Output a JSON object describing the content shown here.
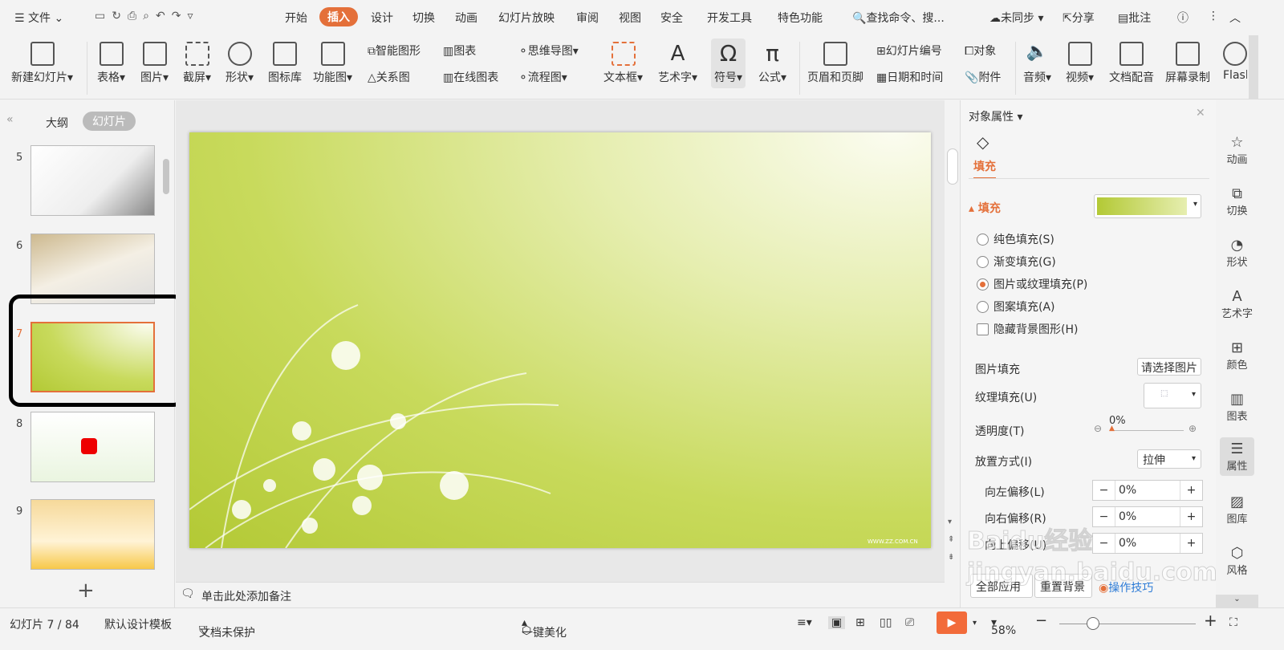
{
  "menubar": {
    "file": "文件",
    "tabs": [
      "开始",
      "插入",
      "设计",
      "切换",
      "动画",
      "幻灯片放映",
      "审阅",
      "视图",
      "安全",
      "开发工具",
      "特色功能"
    ],
    "active_tab": "插入",
    "search": "查找命令、搜...",
    "sync": "未同步",
    "share": "分享",
    "comment": "批注"
  },
  "ribbon": {
    "new_slide": "新建幻灯片",
    "table": "表格",
    "picture": "图片",
    "screenshot": "截屏",
    "shape": "形状",
    "icon_lib": "图标库",
    "func_chart": "功能图",
    "smart_art": "智能图形",
    "chart": "图表",
    "relation": "关系图",
    "online_chart": "在线图表",
    "mind_map": "思维导图",
    "flowchart": "流程图",
    "textbox": "文本框",
    "wordart": "艺术字",
    "symbol": "符号",
    "formula": "公式",
    "header_footer": "页眉和页脚",
    "slide_number": "幻灯片编号",
    "object": "对象",
    "date_time": "日期和时间",
    "attachment": "附件",
    "audio": "音频",
    "video": "视频",
    "voiceover": "文档配音",
    "screen_record": "屏幕录制",
    "flash": "Flash"
  },
  "left_panel": {
    "tab_outline": "大纲",
    "tab_slides": "幻灯片",
    "slides": [
      {
        "num": "5"
      },
      {
        "num": "6"
      },
      {
        "num": "7",
        "selected": true
      },
      {
        "num": "8"
      },
      {
        "num": "9"
      }
    ]
  },
  "slide": {
    "watermark": "WWW.ZZ.COM.CN"
  },
  "notes": "单击此处添加备注",
  "right_panel": {
    "title": "对象属性",
    "tab": "填充",
    "section": "填充",
    "options": [
      {
        "label": "纯色填充(S)",
        "checked": false
      },
      {
        "label": "渐变填充(G)",
        "checked": false
      },
      {
        "label": "图片或纹理填充(P)",
        "checked": true
      },
      {
        "label": "图案填充(A)",
        "checked": false
      }
    ],
    "hide_bg": "隐藏背景图形(H)",
    "picture_fill": "图片填充",
    "picture_fill_btn": "请选择图片",
    "texture_fill": "纹理填充(U)",
    "transparency": "透明度(T)",
    "transparency_value": "0%",
    "transparency_level": 0,
    "placement": "放置方式(I)",
    "placement_value": "拉伸",
    "offsets": [
      {
        "label": "向左偏移(L)",
        "value": "0%"
      },
      {
        "label": "向右偏移(R)",
        "value": "0%"
      },
      {
        "label": "向上偏移(U)",
        "value": "0%"
      }
    ],
    "apply_all": "全部应用",
    "reset_bg": "重置背景",
    "tips": "操作技巧"
  },
  "side_icons": [
    "动画",
    "切换",
    "形状",
    "艺术字",
    "颜色",
    "图表",
    "属性",
    "图库",
    "风格"
  ],
  "status": {
    "slide_count": "幻灯片 7 / 84",
    "template": "默认设计模板",
    "protect": "文档未保护",
    "beautify": "一键美化",
    "zoom": "58%",
    "zoom_level": 58
  },
  "overlay_watermark": "Baidu经验 jingyan.baidu.com",
  "colors": {
    "accent": "#e4703a",
    "highlight_box": "#000000",
    "link": "#2d7bd6"
  }
}
